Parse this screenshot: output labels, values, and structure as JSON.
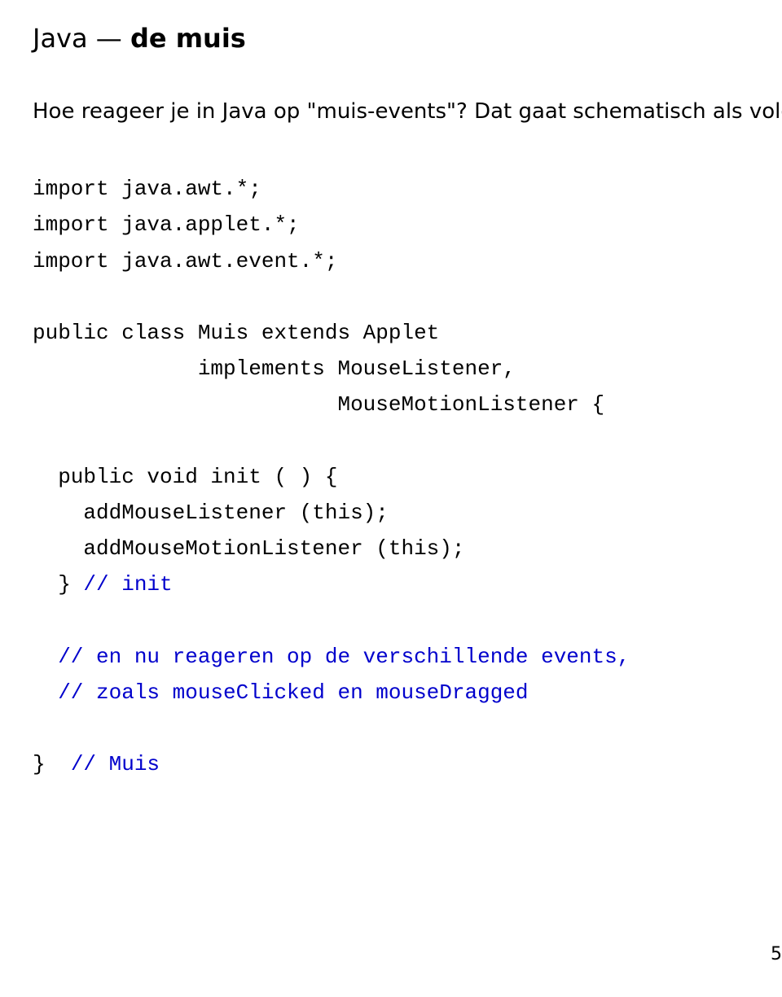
{
  "title": {
    "prefix": "Java — ",
    "bold": "de muis"
  },
  "intro": "Hoe reageer je in Java op \"muis-events\"? Dat gaat schematisch als volgt:",
  "code": {
    "l1": "import java.awt.*;",
    "l2": "import java.applet.*;",
    "l3": "import java.awt.event.*;",
    "l4": "public class Muis extends Applet",
    "l5": "             implements MouseListener,",
    "l6": "                        MouseMotionListener {",
    "l7": "  public void init ( ) {",
    "l8": "    addMouseListener (this);",
    "l9": "    addMouseMotionListener (this);",
    "l10a": "  } ",
    "l10b": "// init",
    "l11": "  // en nu reageren op de verschillende events,",
    "l12": "  // zoals mouseClicked en mouseDragged",
    "l13a": "} ",
    "l13b": " // Muis"
  },
  "page_number": "5"
}
